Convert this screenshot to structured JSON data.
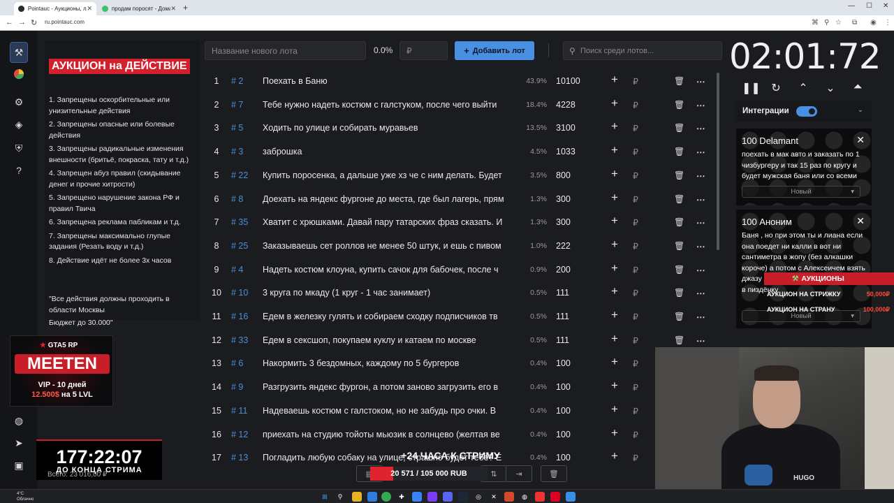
{
  "browser": {
    "tabs": [
      {
        "label": "Pointauc - Аукционы, лотереи",
        "active": true
      },
      {
        "label": "продам поросят - Домашние",
        "active": false
      }
    ],
    "url": "ru.pointauc.com"
  },
  "new_lot": {
    "name_placeholder": "Название нового лота",
    "percent": "0.0%",
    "amount_placeholder": "₽",
    "add_label": "Добавить лот",
    "search_placeholder": "Поиск среди лотов..."
  },
  "rules": {
    "title": "АУКЦИОН на ДЕЙСТВИЕ",
    "items": [
      "1. Запрещены оскорбительные или унизительные действия",
      "2. Запрещены опасные или болевые действия",
      "3. Запрещены радикальные изменения внешности (бритьё, покраска, тату и т.д.)",
      "4. Запрещен абуз правил (скидывание денег и прочие хитрости)",
      "5. Запрещено нарушение закона РФ и правил Твича",
      "6. Запрещена реклама пабликам и т.д.",
      "7.  Запрещены максимально глупые задания (Резать воду и т.д.)",
      "8. Действие идёт не более 3х часов"
    ],
    "quote": "\"Все действия должны проходить в области Москвы",
    "budget": "Бюджет до 30.000\""
  },
  "promo": {
    "brand": "GTA5 RP",
    "name": "MEETEN",
    "vip": "VIP - 10 дней",
    "price_hl": "12.500$",
    "price_rest": " на 5 LVL"
  },
  "stream_timer": {
    "time": "177:22:07",
    "label": "ДО КОНЦА СТРИМА"
  },
  "total_sum": "Всего: 23 016,00 ₽",
  "lots": [
    {
      "idx": "1",
      "id": "# 2",
      "name": "Поехать в Баню",
      "pct": "43.9%",
      "amount": "10100"
    },
    {
      "idx": "2",
      "id": "# 7",
      "name": "Тебе нужно надеть костюм с галстуком, после чего выйти",
      "pct": "18.4%",
      "amount": "4228"
    },
    {
      "idx": "3",
      "id": "# 5",
      "name": "Ходить по улице и собирать муравьев",
      "pct": "13.5%",
      "amount": "3100"
    },
    {
      "idx": "4",
      "id": "# 3",
      "name": "заброшка",
      "pct": "4.5%",
      "amount": "1033"
    },
    {
      "idx": "5",
      "id": "# 22",
      "name": "Купить поросенка, а дальше уже хз че с ним делать. Будет",
      "pct": "3.5%",
      "amount": "800"
    },
    {
      "idx": "6",
      "id": "# 8",
      "name": "Доехать на яндекс фургоне до места, где был лагерь, прям",
      "pct": "1.3%",
      "amount": "300"
    },
    {
      "idx": "7",
      "id": "# 35",
      "name": "Хватит с хрюшками. Давай пару татарских фраз сказать. И",
      "pct": "1.3%",
      "amount": "300"
    },
    {
      "idx": "8",
      "id": "# 25",
      "name": "Заказываешь сет роллов не менее 50 штук, и ешь с пивом",
      "pct": "1.0%",
      "amount": "222"
    },
    {
      "idx": "9",
      "id": "# 4",
      "name": "Надеть костюм клоуна, купить сачок для бабочек, после ч",
      "pct": "0.9%",
      "amount": "200"
    },
    {
      "idx": "10",
      "id": "# 10",
      "name": "3 круга по мкаду (1 круг - 1 час занимает)",
      "pct": "0.5%",
      "amount": "111"
    },
    {
      "idx": "11",
      "id": "# 16",
      "name": "Едем в железку гулять и собираем сходку подписчиков тв",
      "pct": "0.5%",
      "amount": "111"
    },
    {
      "idx": "12",
      "id": "# 33",
      "name": "Едем в сексшоп, покупаем куклу и катаем по москве",
      "pct": "0.5%",
      "amount": "111"
    },
    {
      "idx": "13",
      "id": "# 6",
      "name": "Накормить 3 бездомных, каждому по 5 бургеров",
      "pct": "0.4%",
      "amount": "100"
    },
    {
      "idx": "14",
      "id": "# 9",
      "name": "Разгрузить яндекс фургон, а потом заново загрузить его в",
      "pct": "0.4%",
      "amount": "100"
    },
    {
      "idx": "15",
      "id": "# 11",
      "name": "Надеваешь костюм с галстоком, но не забудь про очки. В",
      "pct": "0.4%",
      "amount": "100"
    },
    {
      "idx": "16",
      "id": "# 12",
      "name": "приехать на студию тойоты мьюзик в солнцево (желтая ве",
      "pct": "0.4%",
      "amount": "100"
    },
    {
      "idx": "17",
      "id": "# 13",
      "name": "Погладить любую собаку на улице, страшно будет тебе? Е",
      "pct": "0.4%",
      "amount": "100"
    }
  ],
  "currency": "₽",
  "timer": "02:01:72",
  "integrations": {
    "label": "Интеграции",
    "enabled": true
  },
  "donations": [
    {
      "amount": "100 Delamant",
      "message": "поехать в мак авто и заказать по 1 чизбургеру и так 15 раз по кругу и будет мужская баня или со всеми",
      "status": "Новый"
    },
    {
      "amount": "100 Аноним",
      "message": "Баня , но при этом ты и лиана если она поедет ни калли в вот ни сантиметра в жопу (без алкашки короче) а потом с Алексеичем взять джазу реального до упада и к лиане в пиздёнку",
      "status": "Новый"
    }
  ],
  "auction_overlay": {
    "tag": "АУКЦИОНЫ",
    "rows": [
      {
        "label": "АУКЦИОН НА СТРИЖКУ",
        "price": "50,000₽"
      },
      {
        "label": "АУКЦИОН НА СТРАНУ",
        "price": "100,000₽"
      }
    ]
  },
  "goal": {
    "label": "+24 ЧАСА К СТРИМУ",
    "progress_text": "20 571 / 105 000 RUB",
    "progress_fraction": 0.196
  },
  "webcam": {
    "shirt_logo": "HUGO"
  },
  "taskbar": {
    "weather_temp": "4°C",
    "weather_desc": "Облачно"
  },
  "colors": {
    "accent": "#4a90e2",
    "brand_red": "#d41f2c",
    "id_blue": "#4a8fd9"
  }
}
